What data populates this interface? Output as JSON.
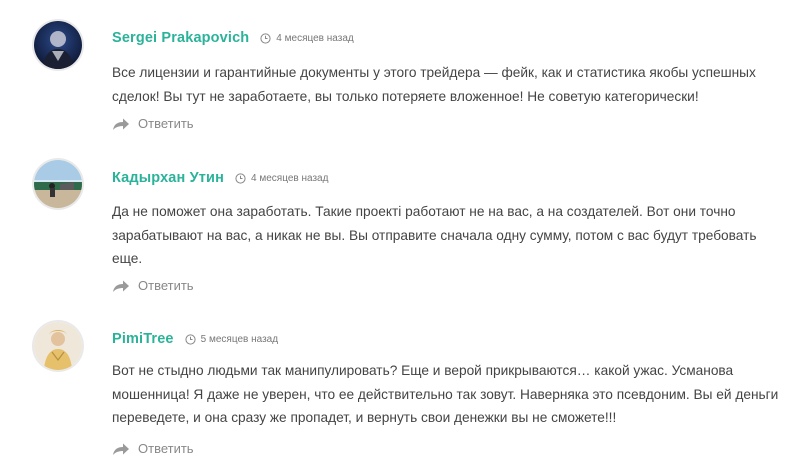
{
  "theme": {
    "author_color": "#2bb39a",
    "text_color": "#444444",
    "muted_color": "#888888"
  },
  "comments": [
    {
      "author": "Sergei Prakapovich",
      "time": "4 месяцев назад",
      "text": "Все лицензии и гарантийные документы у этого трейдера — фейк, как и статистика якобы успешных сделок! Вы тут не заработаете, вы только потеряете вложенное! Не советую категорически!",
      "reply_label": "Ответить",
      "avatar_icon": "user-avatar"
    },
    {
      "author": "Кадырхан Утин",
      "time": "4 месяцев назад",
      "text": "Да не поможет она заработать. Такие проекті работают не на вас, а на создателей. Вот они точно зарабатывают на вас, а никак не вы. Вы отправите сначала одну сумму, потом с вас будут требовать еще.",
      "reply_label": "Ответить",
      "avatar_icon": "user-avatar"
    },
    {
      "author": "PimiTree",
      "time": "5 месяцев назад",
      "text": "Вот не стыдно людьми так манипулировать? Еще и верой прикрываются… какой ужас. Усманова мошенница! Я даже не уверен, что ее действительно так зовут. Наверняка это псевдоним. Вы ей деньги переведете, и она сразу же пропадет, и вернуть свои денежки вы не сможете!!!",
      "reply_label": "Ответить",
      "avatar_icon": "user-avatar"
    }
  ]
}
